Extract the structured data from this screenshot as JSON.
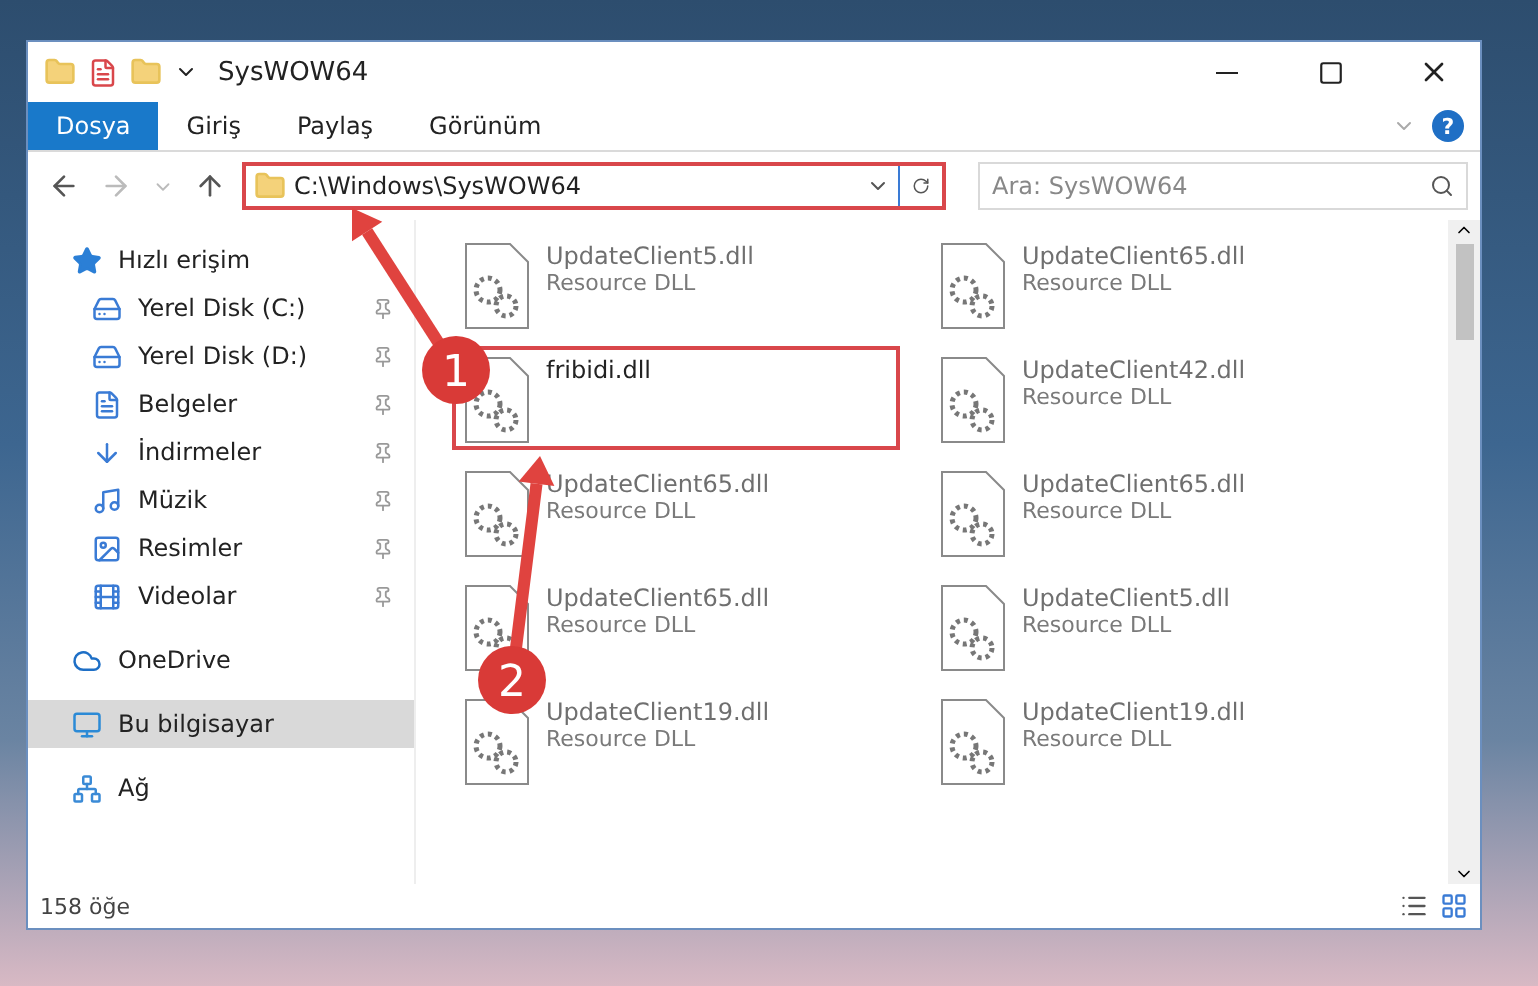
{
  "window": {
    "title": "SysWOW64"
  },
  "ribbon": {
    "tabs": [
      {
        "label": "Dosya",
        "selected": true
      },
      {
        "label": "Giriş",
        "selected": false
      },
      {
        "label": "Paylaş",
        "selected": false
      },
      {
        "label": "Görünüm",
        "selected": false
      }
    ],
    "help": "?"
  },
  "address": {
    "path": "C:\\Windows\\SysWOW64",
    "highlighted": true
  },
  "search": {
    "placeholder": "Ara: SysWOW64"
  },
  "sidebar": {
    "items": [
      {
        "label": "Hızlı erişim",
        "selected": false,
        "children": [
          {
            "label": "Yerel Disk (C:)",
            "pinned": true,
            "selected": false
          },
          {
            "label": "Yerel Disk (D:)",
            "pinned": true,
            "selected": false
          },
          {
            "label": "Belgeler",
            "pinned": true,
            "selected": false
          },
          {
            "label": "İndirmeler",
            "pinned": true,
            "selected": false
          },
          {
            "label": "Müzik",
            "pinned": true,
            "selected": false
          },
          {
            "label": "Resimler",
            "pinned": true,
            "selected": false
          },
          {
            "label": "Videolar",
            "pinned": true,
            "selected": false
          }
        ]
      },
      {
        "label": "OneDrive",
        "selected": false
      },
      {
        "label": "Bu bilgisayar",
        "selected": true
      },
      {
        "label": "Ağ",
        "selected": false
      }
    ]
  },
  "files": [
    {
      "name": "UpdateClient5.dll",
      "type": "Resource DLL",
      "blurred": true,
      "highlighted": false
    },
    {
      "name": "UpdateClient65.dll",
      "type": "Resource DLL",
      "blurred": true,
      "highlighted": false
    },
    {
      "name": "fribidi.dll",
      "blurred": false,
      "highlighted": true
    },
    {
      "name": "UpdateClient42.dll",
      "type": "Resource DLL",
      "blurred": true,
      "highlighted": false
    },
    {
      "name": "UpdateClient65.dll",
      "type": "Resource DLL",
      "blurred": true,
      "highlighted": false
    },
    {
      "name": "UpdateClient65.dll",
      "type": "Resource DLL",
      "blurred": true,
      "highlighted": false
    },
    {
      "name": "UpdateClient65.dll",
      "type": "Resource DLL",
      "blurred": true,
      "highlighted": false
    },
    {
      "name": "UpdateClient5.dll",
      "type": "Resource DLL",
      "blurred": true,
      "highlighted": false
    },
    {
      "name": "UpdateClient19.dll",
      "type": "Resource DLL",
      "blurred": true,
      "highlighted": false
    },
    {
      "name": "UpdateClient19.dll",
      "type": "Resource DLL",
      "blurred": true,
      "highlighted": false
    }
  ],
  "status_bar": {
    "count": "158 öğe"
  },
  "annotations": [
    {
      "label": "1"
    },
    {
      "label": "2"
    }
  ]
}
